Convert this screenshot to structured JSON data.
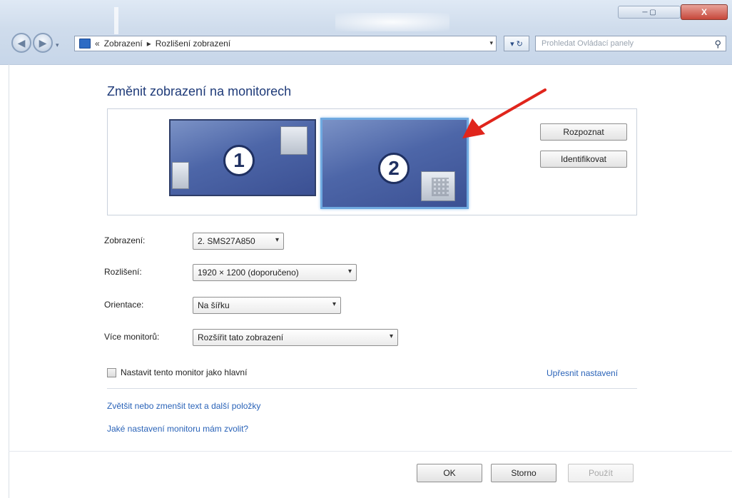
{
  "window": {
    "close_label": "X",
    "min_max_label": "─ ▢"
  },
  "nav": {
    "back_glyph": "◀",
    "forward_glyph": "▶",
    "dropdown_glyph": "▾"
  },
  "address": {
    "crumb_prefix": "«",
    "crumb_1": "Zobrazení",
    "crumb_sep": "▸",
    "crumb_2": "Rozlišení zobrazení",
    "dropdown_glyph": "▾"
  },
  "refresh_label": "▾ ↻",
  "search": {
    "placeholder": "Prohledat Ovládací panely",
    "icon": "search-icon"
  },
  "page": {
    "heading": "Změnit zobrazení na monitorech"
  },
  "monitors": [
    {
      "number": "1"
    },
    {
      "number": "2",
      "selected": true
    }
  ],
  "buttons": {
    "detect": "Rozpoznat",
    "identify": "Identifikovat",
    "ok": "OK",
    "cancel": "Storno",
    "apply": "Použít"
  },
  "form": {
    "display_label": "Zobrazení:",
    "display_value": "2. SMS27A850",
    "resolution_label": "Rozlišení:",
    "resolution_value": "1920 × 1200 (doporučeno)",
    "orientation_label": "Orientace:",
    "orientation_value": "Na šířku",
    "multi_label": "Více monitorů:",
    "multi_value": "Rozšířit tato zobrazení",
    "dropdown_glyph": "▾"
  },
  "checkbox": {
    "label": "Nastavit tento monitor jako hlavní",
    "checked": false
  },
  "links": {
    "advanced": "Upřesnit nastavení",
    "text_size": "Zvětšit nebo zmenšit text a další položky",
    "which_settings": "Jaké nastavení monitoru mám zvolit?"
  },
  "colors": {
    "accent_link": "#2a63b8",
    "heading": "#1e3a78",
    "arrow": "#e0251c"
  }
}
